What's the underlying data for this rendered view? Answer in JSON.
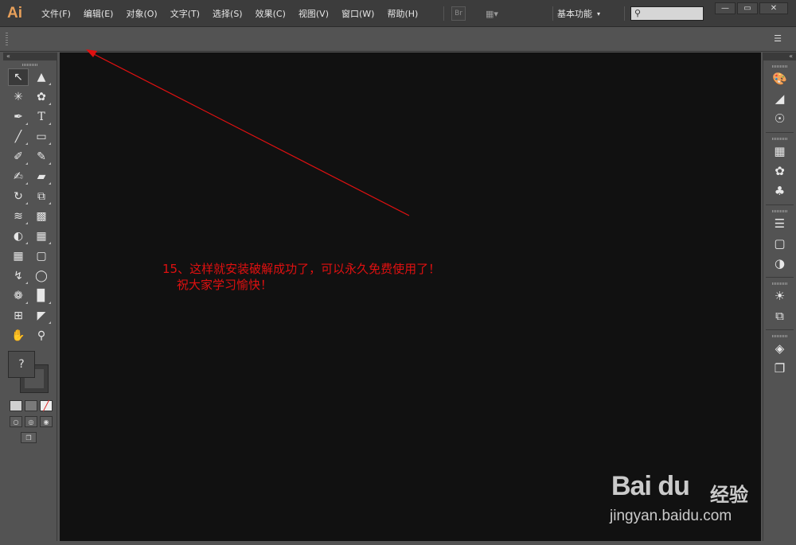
{
  "app": {
    "logo": "Ai"
  },
  "menu": [
    {
      "label": "文件(F)"
    },
    {
      "label": "编辑(E)"
    },
    {
      "label": "对象(O)"
    },
    {
      "label": "文字(T)"
    },
    {
      "label": "选择(S)"
    },
    {
      "label": "效果(C)"
    },
    {
      "label": "视图(V)"
    },
    {
      "label": "窗口(W)"
    },
    {
      "label": "帮助(H)"
    }
  ],
  "toolbar_buttons": {
    "bridge": "Br",
    "arrange": "▦▾"
  },
  "workspace": {
    "label": "基本功能",
    "caret": "▾"
  },
  "search": {
    "icon": "search-icon",
    "placeholder": ""
  },
  "window_controls": {
    "minimize": "—",
    "restore": "▭",
    "close": "✕"
  },
  "tools": [
    [
      "selection",
      "direct-selection"
    ],
    [
      "magic-wand",
      "lasso"
    ],
    [
      "pen",
      "type"
    ],
    [
      "line-segment",
      "rectangle"
    ],
    [
      "paintbrush",
      "pencil"
    ],
    [
      "blob-brush",
      "eraser"
    ],
    [
      "rotate",
      "scale"
    ],
    [
      "width",
      "free-transform"
    ],
    [
      "shape-builder",
      "perspective-grid"
    ],
    [
      "mesh",
      "gradient"
    ],
    [
      "eyedropper",
      "blend"
    ],
    [
      "symbol-sprayer",
      "column-graph"
    ],
    [
      "artboard",
      "slice"
    ],
    [
      "hand",
      "zoom"
    ]
  ],
  "fill": {
    "label": "?"
  },
  "annotation": {
    "line1": "15、这样就安装破解成功了，可以永久免费使用了！",
    "line2": "祝大家学习愉快！",
    "color": "#e01010"
  },
  "watermark": {
    "brand": "Bai du",
    "brand_cn": "经验",
    "url": "jingyan.baidu.com"
  }
}
